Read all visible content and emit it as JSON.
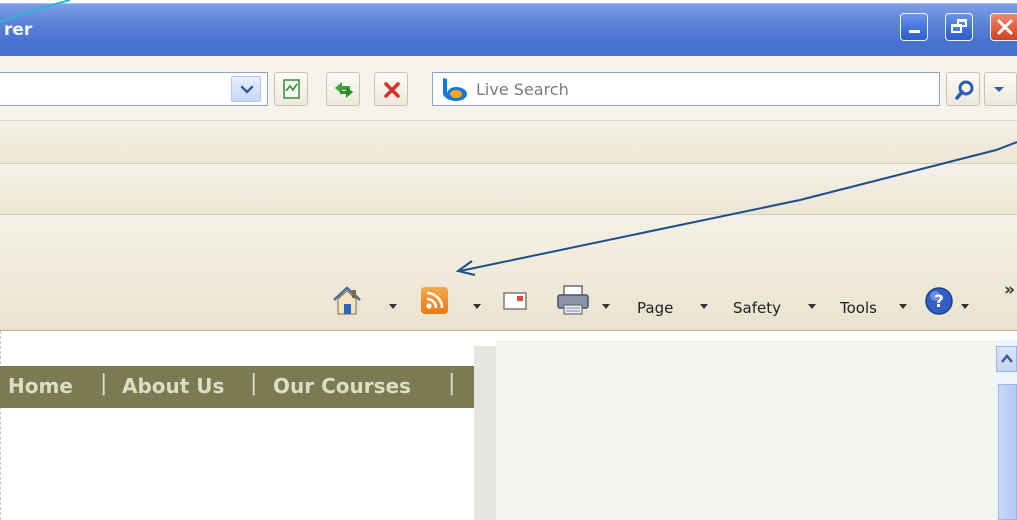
{
  "window": {
    "title_fragment": "rer",
    "controls": [
      "minimize",
      "restore",
      "close"
    ]
  },
  "address_bar": {
    "value": "",
    "buttons": [
      "dropdown",
      "compatibility",
      "refresh",
      "stop"
    ]
  },
  "search": {
    "placeholder": "Live Search",
    "engine_icon": "bing-logo-icon"
  },
  "command_bar": {
    "items": [
      {
        "label": "Page"
      },
      {
        "label": "Safety"
      },
      {
        "label": "Tools"
      }
    ],
    "icons": [
      "home-icon",
      "feeds-icon",
      "mail-icon",
      "print-icon",
      "help-icon"
    ],
    "overflow": "»"
  },
  "page": {
    "nav": [
      "Home",
      "About Us",
      "Our Courses"
    ],
    "separator": "|"
  },
  "colors": {
    "titlebar": "#4a73cf",
    "nav_bg": "#7c7a52",
    "nav_text": "#dedec2",
    "annotation_arrow": "#1f4e8c",
    "feed_orange": "#f08a24"
  }
}
